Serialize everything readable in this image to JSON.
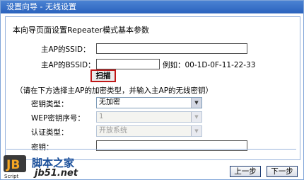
{
  "window": {
    "title": "设置向导 - 无线设置"
  },
  "form": {
    "heading": "本向导页面设置Repeater模式基本参数",
    "ssid_label": "主AP的SSID：",
    "ssid_value": "",
    "bssid_label": "主AP的BSSID：",
    "bssid_value": "",
    "bssid_example": "例如：00-1D-0F-11-22-33",
    "scan_label": "扫描",
    "hint": "（请在下方选择主AP的加密类型，并输入主AP的无线密钥）",
    "key_type_label": "密钥类型：",
    "key_type_value": "无加密",
    "wep_index_label": "WEP密钥序号：",
    "wep_index_value": "1",
    "auth_type_label": "认证类型：",
    "auth_type_value": "开放系统",
    "key_label": "密钥：",
    "key_value": ""
  },
  "buttons": {
    "prev": "上一步",
    "next": "下一步"
  },
  "watermark": {
    "brand": "脚本之家",
    "url": "jb51.net",
    "logo_letters": "JB",
    "logo_sub": "Script"
  },
  "colors": {
    "titlebar": "#2a62bd",
    "scan_border": "#c01818"
  }
}
